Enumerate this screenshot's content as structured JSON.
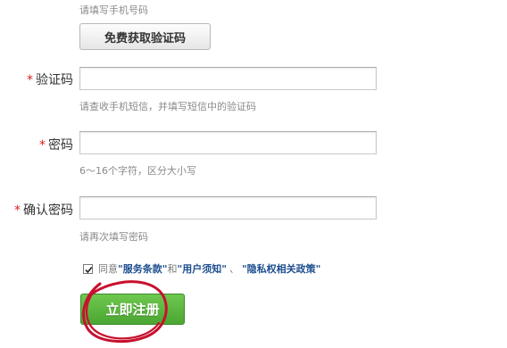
{
  "phone": {
    "hint": "请填写手机号码",
    "get_code_label": "免费获取验证码"
  },
  "code": {
    "required_mark": "*",
    "label": "验证码",
    "value": "",
    "hint": "请查收手机短信，并填写短信中的验证码"
  },
  "password": {
    "required_mark": "*",
    "label": "密码",
    "value": "",
    "hint": "6～16个字符，区分大小写"
  },
  "confirm_password": {
    "required_mark": "*",
    "label": "确认密码",
    "value": "",
    "hint": "请再次填写密码"
  },
  "agreement": {
    "checked": true,
    "prefix": "同意",
    "term1": "\"服务条款\"",
    "joiner": "和",
    "term2": "\"用户须知\"",
    "separator": "、",
    "term3": "\"隐私权相关政策\""
  },
  "register": {
    "label": "立即注册"
  },
  "colors": {
    "required_mark": "#d61f1f",
    "term_link": "#1d4e8f",
    "register_button": "#4aa732",
    "annotation_circle": "#c8102e"
  }
}
